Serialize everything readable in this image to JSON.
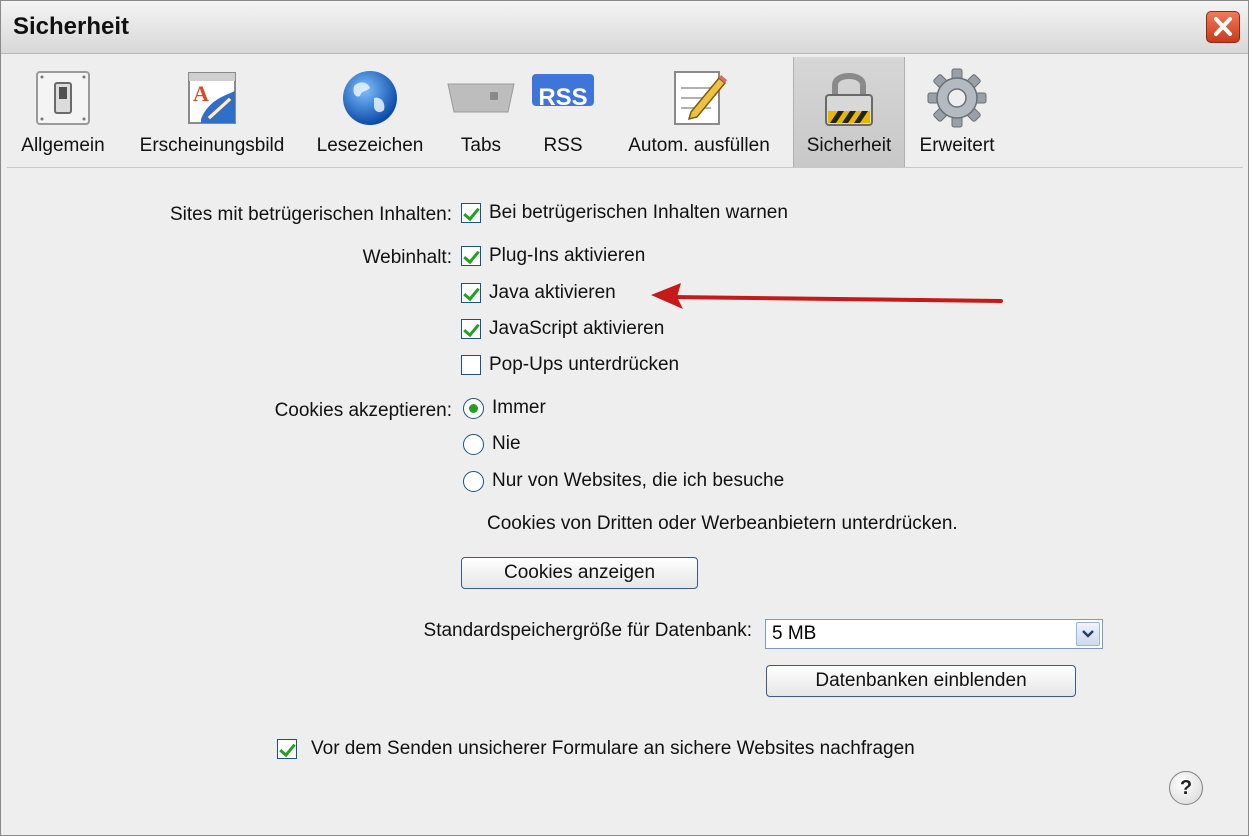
{
  "window": {
    "title": "Sicherheit"
  },
  "toolbar": {
    "items": [
      {
        "label": "Allgemein",
        "icon": "switch-icon"
      },
      {
        "label": "Erscheinungsbild",
        "icon": "appearance-icon"
      },
      {
        "label": "Lesezeichen",
        "icon": "globe-icon"
      },
      {
        "label": "Tabs",
        "icon": "tabs-icon"
      },
      {
        "label": "RSS",
        "icon": "rss-icon"
      },
      {
        "label": "Autom. ausfüllen",
        "icon": "pencil-form-icon"
      },
      {
        "label": "Sicherheit",
        "icon": "lock-icon",
        "selected": true
      },
      {
        "label": "Erweitert",
        "icon": "gear-icon"
      }
    ],
    "rss_badge": "RSS"
  },
  "fraud": {
    "label": "Sites mit betrügerischen Inhalten:",
    "option": {
      "label": "Bei betrügerischen Inhalten warnen",
      "checked": true
    }
  },
  "webcontent": {
    "label": "Webinhalt:",
    "options": [
      {
        "label": "Plug-Ins aktivieren",
        "checked": true
      },
      {
        "label": "Java aktivieren",
        "checked": true
      },
      {
        "label": "JavaScript aktivieren",
        "checked": true
      },
      {
        "label": "Pop-Ups unterdrücken",
        "checked": false
      }
    ]
  },
  "cookies": {
    "label": "Cookies akzeptieren:",
    "options": [
      {
        "label": "Immer",
        "selected": true
      },
      {
        "label": "Nie",
        "selected": false
      },
      {
        "label": "Nur von Websites, die ich besuche",
        "selected": false
      }
    ],
    "note": "Cookies von Dritten oder Werbeanbietern unterdrücken.",
    "show_button": "Cookies anzeigen"
  },
  "database": {
    "label": "Standardspeichergröße für Datenbank:",
    "value": "5 MB",
    "show_button": "Datenbanken einblenden"
  },
  "forms": {
    "label": "Vor dem Senden unsicherer Formulare an sichere Websites nachfragen",
    "checked": true
  },
  "help": {
    "label": "?"
  },
  "colors": {
    "arrow": "#c41a1a",
    "check": "#21a121",
    "close": "#d9482a"
  }
}
